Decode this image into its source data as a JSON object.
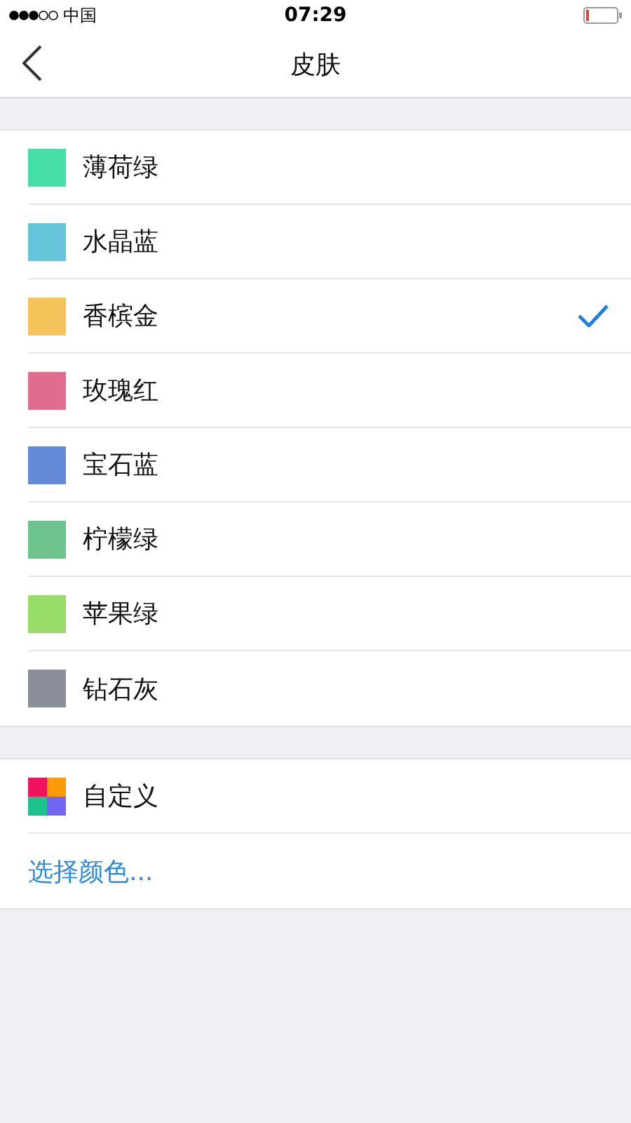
{
  "status_bar": {
    "carrier": "中国",
    "time": "07:29"
  },
  "nav": {
    "title": "皮肤"
  },
  "skins": [
    {
      "name": "薄荷绿",
      "color": "#45dea6",
      "selected": false
    },
    {
      "name": "水晶蓝",
      "color": "#66c4da",
      "selected": false
    },
    {
      "name": "香槟金",
      "color": "#f4c35a",
      "selected": true
    },
    {
      "name": "玫瑰红",
      "color": "#e06c8e",
      "selected": false
    },
    {
      "name": "宝石蓝",
      "color": "#638ad6",
      "selected": false
    },
    {
      "name": "柠檬绿",
      "color": "#6cc48c",
      "selected": false
    },
    {
      "name": "苹果绿",
      "color": "#97dc67",
      "selected": false
    },
    {
      "name": "钻石灰",
      "color": "#898e99",
      "selected": false
    }
  ],
  "custom": {
    "name": "自定义",
    "action": "选择颜色..."
  }
}
